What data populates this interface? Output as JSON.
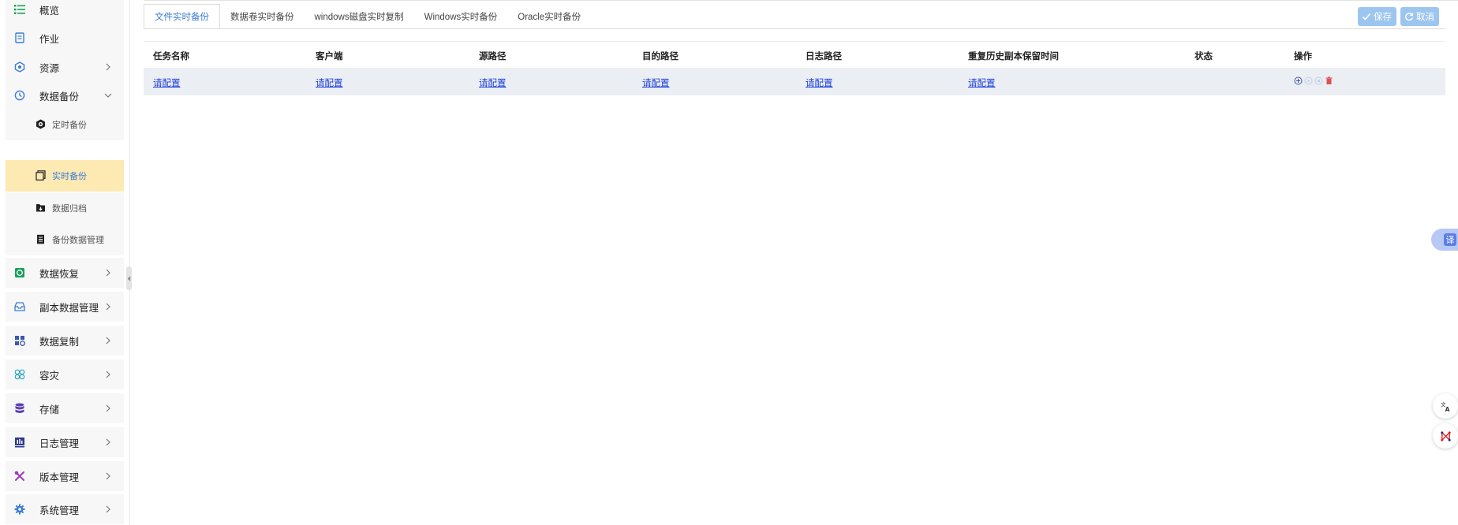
{
  "sidebar": {
    "items": [
      {
        "label": "概览",
        "icon": "list-icon",
        "color": "#18a058"
      },
      {
        "label": "作业",
        "icon": "document-icon",
        "color": "#3a7bd5"
      },
      {
        "label": "资源",
        "icon": "hexagon-icon",
        "color": "#3a7bd5"
      },
      {
        "label": "数据备份",
        "icon": "history-icon",
        "color": "#3a7bd5"
      },
      {
        "label": "数据恢复",
        "icon": "image-restore-icon",
        "color": "#18a058"
      },
      {
        "label": "副本数据管理",
        "icon": "inbox-icon",
        "color": "#3a7bd5"
      },
      {
        "label": "数据复制",
        "icon": "grid-copy-icon",
        "color": "#3a5aa8"
      },
      {
        "label": "容灾",
        "icon": "rings-icon",
        "color": "#2ba5c5"
      },
      {
        "label": "存储",
        "icon": "database-icon",
        "color": "#5a3fb8"
      },
      {
        "label": "日志管理",
        "icon": "log-chart-icon",
        "color": "#2d3a8c"
      },
      {
        "label": "版本管理",
        "icon": "tools-icon",
        "color": "#9b3fb0"
      },
      {
        "label": "系统管理",
        "icon": "gear-icon",
        "color": "#3a7bd5"
      }
    ],
    "sub_items": [
      {
        "label": "定时备份",
        "icon": "timer-icon"
      },
      {
        "label": "实时备份",
        "icon": "copy-icon",
        "active": true
      },
      {
        "label": "数据归档",
        "icon": "archive-icon"
      },
      {
        "label": "备份数据管理",
        "icon": "file-list-icon"
      }
    ]
  },
  "tabs": [
    {
      "label": "文件实时备份",
      "active": true
    },
    {
      "label": "数据卷实时备份"
    },
    {
      "label": "windows磁盘实时复制"
    },
    {
      "label": "Windows实时备份"
    },
    {
      "label": "Oracle实时备份"
    }
  ],
  "toolbar": {
    "save_label": "保存",
    "cancel_label": "取消"
  },
  "table": {
    "columns": [
      "任务名称",
      "客户端",
      "源路径",
      "目的路径",
      "日志路径",
      "重复历史副本保留时间",
      "状态",
      "操作"
    ],
    "rows": [
      {
        "cells": [
          "请配置",
          "请配置",
          "请配置",
          "请配置",
          "请配置",
          "请配置",
          "",
          ""
        ]
      }
    ]
  },
  "floating": {
    "translate_char": "译"
  },
  "colors": {
    "accent": "#3a7bd5",
    "active_bg": "#fde9b2",
    "button_bg": "#9cc6ef",
    "link": "#1a3ddb",
    "delete": "#e05050"
  }
}
